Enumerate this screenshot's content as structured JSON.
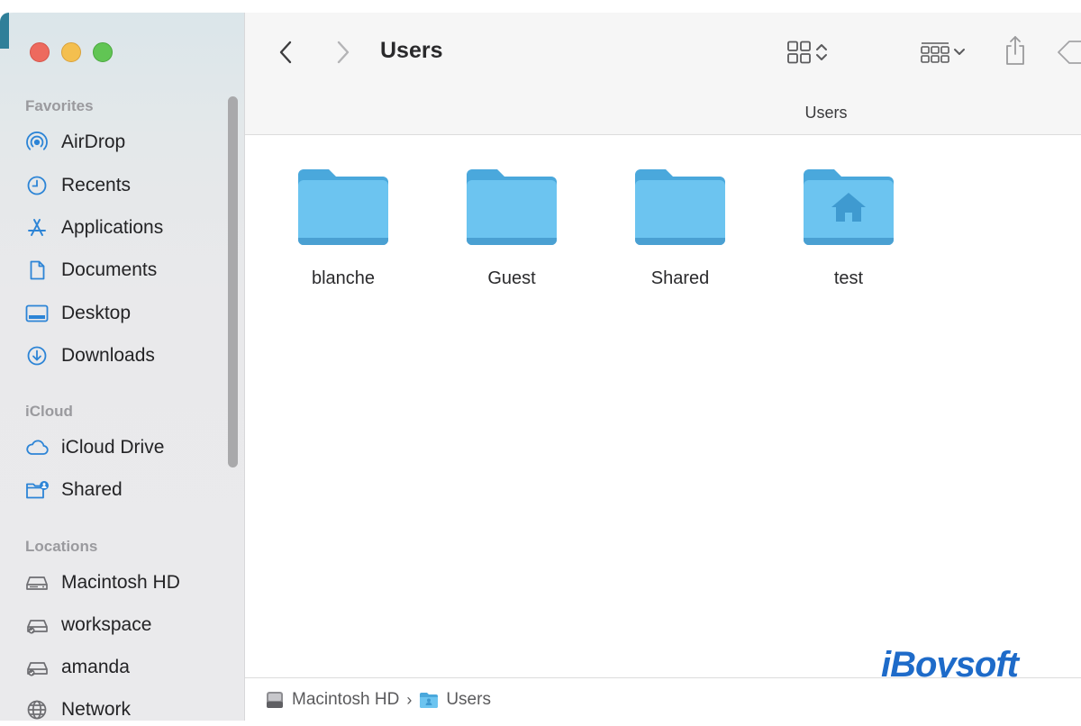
{
  "window": {
    "title": "Users",
    "path_title": "Users"
  },
  "sidebar": {
    "sections": [
      {
        "title": "Favorites",
        "items": [
          {
            "label": "AirDrop",
            "icon": "airdrop-icon"
          },
          {
            "label": "Recents",
            "icon": "clock-icon"
          },
          {
            "label": "Applications",
            "icon": "applications-icon"
          },
          {
            "label": "Documents",
            "icon": "document-icon"
          },
          {
            "label": "Desktop",
            "icon": "desktop-icon"
          },
          {
            "label": "Downloads",
            "icon": "download-icon"
          }
        ]
      },
      {
        "title": "iCloud",
        "items": [
          {
            "label": "iCloud Drive",
            "icon": "cloud-icon"
          },
          {
            "label": "Shared",
            "icon": "shared-folder-icon"
          }
        ]
      },
      {
        "title": "Locations",
        "items": [
          {
            "label": "Macintosh HD",
            "icon": "hard-drive-icon"
          },
          {
            "label": "workspace",
            "icon": "network-drive-icon"
          },
          {
            "label": "amanda",
            "icon": "network-drive-icon"
          },
          {
            "label": "Network",
            "icon": "globe-icon"
          }
        ]
      }
    ]
  },
  "folders": [
    {
      "name": "blanche",
      "icon": "folder-icon"
    },
    {
      "name": "Guest",
      "icon": "folder-icon"
    },
    {
      "name": "Shared",
      "icon": "folder-icon"
    },
    {
      "name": "test",
      "icon": "home-folder-icon"
    }
  ],
  "pathbar": {
    "items": [
      {
        "label": "Macintosh HD",
        "icon": "hard-drive-icon"
      },
      {
        "label": "Users",
        "icon": "users-folder-icon"
      }
    ]
  },
  "watermark": {
    "text": "iBoysoft"
  },
  "colors": {
    "accent": "#2c84d6",
    "folder": "#6cc4f0",
    "folder_tab": "#4aa8dc",
    "watermark": "#1e6bc9"
  }
}
